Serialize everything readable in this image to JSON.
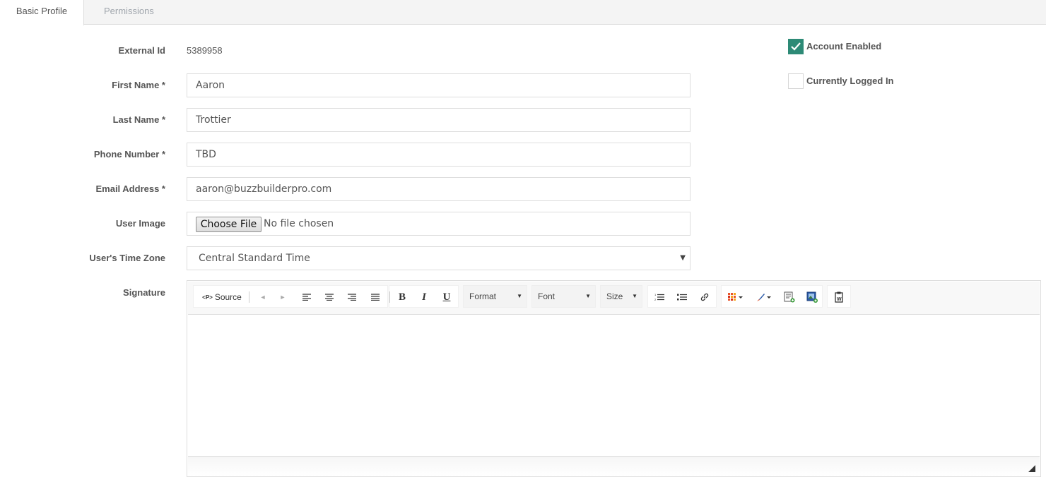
{
  "tabs": [
    {
      "label": "Basic Profile",
      "active": true
    },
    {
      "label": "Permissions",
      "active": false
    }
  ],
  "form": {
    "external_id_label": "External Id",
    "external_id_value": "5389958",
    "first_name_label": "First Name *",
    "first_name_value": "Aaron",
    "last_name_label": "Last Name *",
    "last_name_value": "Trottier",
    "phone_label": "Phone Number *",
    "phone_value": "TBD",
    "email_label": "Email Address *",
    "email_value": "aaron@buzzbuilderpro.com",
    "user_image_label": "User Image",
    "choose_file_label": "Choose File",
    "no_file_text": "No file chosen",
    "timezone_label": "User's Time Zone",
    "timezone_value": "Central Standard Time",
    "signature_label": "Signature"
  },
  "checks": {
    "account_enabled_label": "Account Enabled",
    "account_enabled": true,
    "logged_in_label": "Currently Logged In",
    "logged_in": false
  },
  "editor": {
    "source_label": "Source",
    "source_tag": "<P>",
    "format_label": "Format",
    "font_label": "Font",
    "size_label": "Size",
    "bold_glyph": "B",
    "italic_glyph": "I",
    "underline_glyph": "U"
  },
  "colors": {
    "accent": "#2d8a76",
    "border": "#dddddd"
  }
}
